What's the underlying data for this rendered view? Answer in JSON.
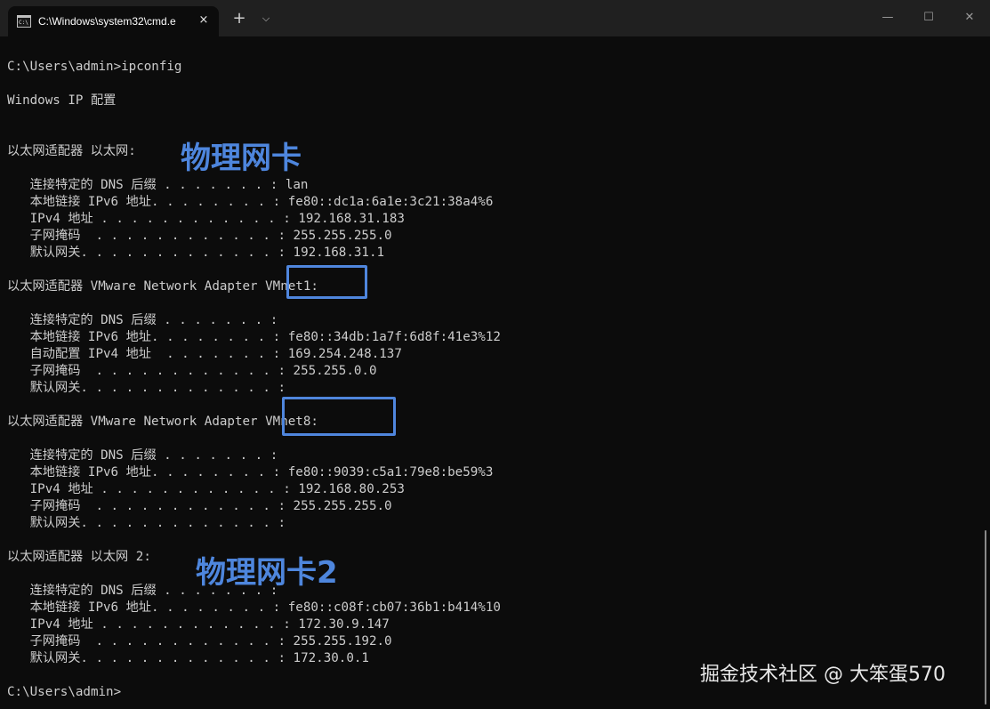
{
  "window": {
    "tab_title": "C:\\Windows\\system32\\cmd.e",
    "tab_close_icon": "×",
    "new_tab_icon": "+",
    "dropdown_icon": "⌵",
    "minimize_icon": "—",
    "maximize_icon": "☐",
    "close_icon": "✕"
  },
  "console": {
    "lines": [
      "C:\\Users\\admin>ipconfig",
      "",
      "Windows IP 配置",
      "",
      "",
      "以太网适配器 以太网:",
      "",
      "   连接特定的 DNS 后缀 . . . . . . . : lan",
      "   本地链接 IPv6 地址. . . . . . . . : fe80::dc1a:6a1e:3c21:38a4%6",
      "   IPv4 地址 . . . . . . . . . . . . : 192.168.31.183",
      "   子网掩码  . . . . . . . . . . . . : 255.255.255.0",
      "   默认网关. . . . . . . . . . . . . : 192.168.31.1",
      "",
      "以太网适配器 VMware Network Adapter VMnet1:",
      "",
      "   连接特定的 DNS 后缀 . . . . . . . :",
      "   本地链接 IPv6 地址. . . . . . . . : fe80::34db:1a7f:6d8f:41e3%12",
      "   自动配置 IPv4 地址  . . . . . . . : 169.254.248.137",
      "   子网掩码  . . . . . . . . . . . . : 255.255.0.0",
      "   默认网关. . . . . . . . . . . . . :",
      "",
      "以太网适配器 VMware Network Adapter VMnet8:",
      "",
      "   连接特定的 DNS 后缀 . . . . . . . :",
      "   本地链接 IPv6 地址. . . . . . . . : fe80::9039:c5a1:79e8:be59%3",
      "   IPv4 地址 . . . . . . . . . . . . : 192.168.80.253",
      "   子网掩码  . . . . . . . . . . . . : 255.255.255.0",
      "   默认网关. . . . . . . . . . . . . :",
      "",
      "以太网适配器 以太网 2:",
      "",
      "   连接特定的 DNS 后缀 . . . . . . . :",
      "   本地链接 IPv6 地址. . . . . . . . : fe80::c08f:cb07:36b1:b414%10",
      "   IPv4 地址 . . . . . . . . . . . . : 172.30.9.147",
      "   子网掩码  . . . . . . . . . . . . : 255.255.192.0",
      "   默认网关. . . . . . . . . . . . . : 172.30.0.1",
      "",
      "C:\\Users\\admin>"
    ]
  },
  "annotations": {
    "label_1": "物理网卡",
    "label_2": "物理网卡2",
    "color": "#4e86dd"
  },
  "watermark": "掘金技术社区 @ 大笨蛋570",
  "colors": {
    "console_bg": "#0c0c0c",
    "console_text": "#cccccc",
    "titlebar_bg": "#202020"
  }
}
